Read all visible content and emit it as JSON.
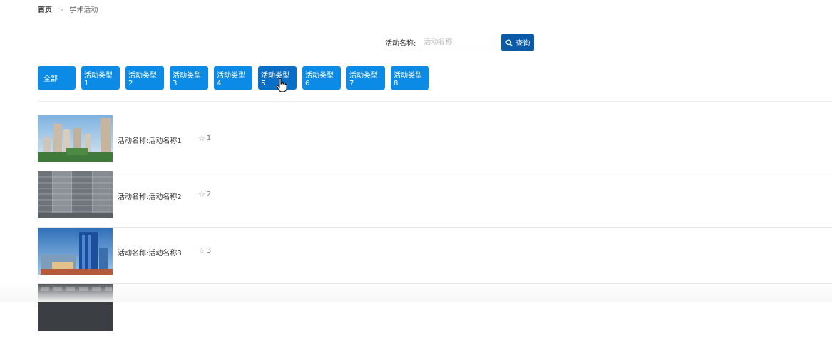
{
  "breadcrumb": {
    "home": "首页",
    "separator": ">",
    "current": "学术活动"
  },
  "search": {
    "label": "活动名称:",
    "placeholder": "活动名称",
    "value": "",
    "button_label": "查询",
    "button_icon": "search-icon"
  },
  "tabs": [
    {
      "label": "全部"
    },
    {
      "label": "活动类型1"
    },
    {
      "label": "活动类型2"
    },
    {
      "label": "活动类型3"
    },
    {
      "label": "活动类型4"
    },
    {
      "label": "活动类型5"
    },
    {
      "label": "活动类型6"
    },
    {
      "label": "活动类型7"
    },
    {
      "label": "活动类型8"
    }
  ],
  "items": [
    {
      "name": "活动名称:活动名称1",
      "count": "1",
      "icon": "star-outline-icon"
    },
    {
      "name": "活动名称:活动名称2",
      "count": "2",
      "icon": "star-outline-icon"
    },
    {
      "name": "活动名称:活动名称3",
      "count": "3",
      "icon": "star-outline-icon"
    }
  ],
  "colors": {
    "tab": "#0b8ae6",
    "tab_active": "#0a6fc4",
    "search_button": "#0a5aa8"
  }
}
